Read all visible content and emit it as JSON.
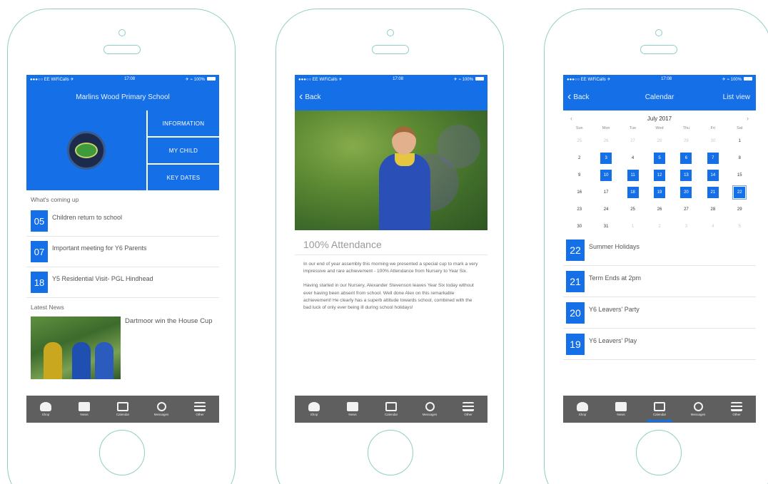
{
  "screen1": {
    "status": {
      "carrier": "●●●○○ EE WiFiCalls ✈",
      "time": "17:08",
      "battery": "✈ ⌁ 100%"
    },
    "header": {
      "title": "Marlins Wood Primary School"
    },
    "menu": [
      {
        "label": "INFORMATION"
      },
      {
        "label": "MY CHILD"
      },
      {
        "label": "KEY DATES"
      }
    ],
    "coming_up_heading": "What's coming up",
    "events": [
      {
        "day": "05",
        "title": "Children return to school"
      },
      {
        "day": "07",
        "title": "Important meeting for Y6 Parents"
      },
      {
        "day": "18",
        "title": "Y5 Residential Visit- PGL Hindhead"
      }
    ],
    "news_heading": "Latest News",
    "news": {
      "title": "Dartmoor win the House Cup"
    }
  },
  "screen2": {
    "status": {
      "carrier": "●●●○○ EE WiFiCalls ✈",
      "time": "17:08",
      "battery": "✈ ⌁ 100%"
    },
    "back_label": "Back",
    "article_title": "100% Attendance",
    "paragraphs": [
      "In our end of year assembly this morning we presented a special cup to mark a very impressive and rare achievement - 100% Attendance from Nursery to Year Six.",
      "Having started in our Nursery, Alexander Stevenson leaves Year Six today without ever having been absent from school. Well done Alex on this remarkable achievement! He clearly has a superb attitude towards school, combined with the bad luck of only ever being ill during school holidays!"
    ]
  },
  "screen3": {
    "status": {
      "carrier": "●●●○○ EE WiFiCalls ✈",
      "time": "17:08",
      "battery": "✈ ⌁ 100%"
    },
    "back_label": "Back",
    "title": "Calendar",
    "right_label": "List view",
    "month": "July 2017",
    "prev_arrow": "‹",
    "next_arrow": "›",
    "weekdays": [
      "Sun",
      "Mon",
      "Tue",
      "Wed",
      "Thu",
      "Fri",
      "Sat"
    ],
    "days": [
      {
        "d": "25",
        "muted": true
      },
      {
        "d": "26",
        "muted": true
      },
      {
        "d": "27",
        "muted": true
      },
      {
        "d": "28",
        "muted": true
      },
      {
        "d": "29",
        "muted": true
      },
      {
        "d": "30",
        "muted": true
      },
      {
        "d": "1"
      },
      {
        "d": "2"
      },
      {
        "d": "3",
        "hl": true
      },
      {
        "d": "4"
      },
      {
        "d": "5",
        "hl": true
      },
      {
        "d": "6",
        "hl": true
      },
      {
        "d": "7",
        "hl": true
      },
      {
        "d": "8"
      },
      {
        "d": "9"
      },
      {
        "d": "10",
        "hl": true
      },
      {
        "d": "11",
        "hl": true
      },
      {
        "d": "12",
        "hl": true
      },
      {
        "d": "13",
        "hl": true
      },
      {
        "d": "14",
        "hl": true
      },
      {
        "d": "15"
      },
      {
        "d": "16"
      },
      {
        "d": "17"
      },
      {
        "d": "18",
        "hl": true
      },
      {
        "d": "19",
        "hl": true
      },
      {
        "d": "20",
        "hl": true
      },
      {
        "d": "21",
        "hl": true
      },
      {
        "d": "22",
        "hl": true,
        "outline": true
      },
      {
        "d": "23"
      },
      {
        "d": "24"
      },
      {
        "d": "25"
      },
      {
        "d": "26"
      },
      {
        "d": "27"
      },
      {
        "d": "28"
      },
      {
        "d": "29"
      },
      {
        "d": "30"
      },
      {
        "d": "31"
      },
      {
        "d": "1",
        "muted": true
      },
      {
        "d": "2",
        "muted": true
      },
      {
        "d": "3",
        "muted": true
      },
      {
        "d": "4",
        "muted": true
      },
      {
        "d": "5",
        "muted": true
      }
    ],
    "events": [
      {
        "day": "22",
        "title": "Summer Holidays"
      },
      {
        "day": "21",
        "title": "Term Ends at 2pm"
      },
      {
        "day": "20",
        "title": "Y6 Leavers' Party"
      },
      {
        "day": "19",
        "title": "Y6 Leavers' Play"
      }
    ]
  },
  "tabbar": [
    {
      "label": "Shop",
      "icon": "shop-icon"
    },
    {
      "label": "News",
      "icon": "news-icon"
    },
    {
      "label": "Calendar",
      "icon": "calendar-icon"
    },
    {
      "label": "Messages",
      "icon": "messages-icon"
    },
    {
      "label": "Other",
      "icon": "menu-icon"
    }
  ],
  "colors": {
    "accent": "#1570e8",
    "tabbar": "#5f5f5f",
    "frame": "#8fcfc7"
  }
}
